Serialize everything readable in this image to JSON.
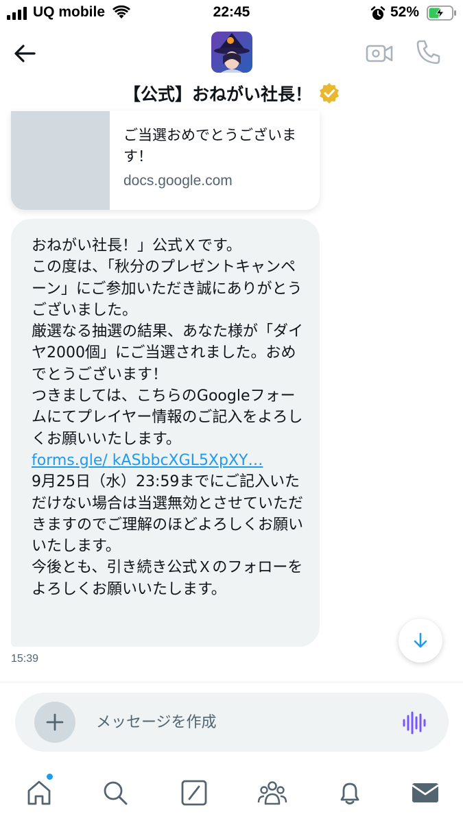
{
  "status_bar": {
    "carrier": "UQ mobile",
    "time": "22:45",
    "battery_percent": "52%",
    "battery_level": 0.52,
    "icons": [
      "signal-icon",
      "wifi-icon",
      "alarm-icon",
      "battery-charging-icon"
    ]
  },
  "header": {
    "title": "【公式】おねがい社長！",
    "verified": true,
    "icons": [
      "back-arrow-icon",
      "video-call-icon",
      "phone-icon",
      "verified-badge-icon"
    ]
  },
  "link_card": {
    "title": "ご当選おめでとうございます！",
    "domain": "docs.google.com"
  },
  "message": {
    "text_before_link": "おねがい社長！」公式Ｘです。\nこの度は、「秋分のプレゼントキャンペーン」にご参加いただき誠にありがとうございました。\n厳選なる抽選の結果、あなた様が「ダイヤ2000個」にご当選されました。おめでとうございます！\nつきましては、こちらのGoogleフォームにてプレイヤー情報のご記入をよろしくお願いいたします。 ",
    "link_line1": "forms.gle/",
    "link_line2": "kASbbcXGL5XpXY…",
    "text_after_link": "\n9月25日（水）23:59までにご記入いただけない場合は当選無効とさせていただきますのでご理解のほどよろしくお願いいたします。\n今後とも、引き続き公式Ｘのフォローをよろしくお願いいたします。",
    "timestamp": "15:39"
  },
  "composer": {
    "placeholder": "メッセージを作成",
    "value": ""
  },
  "bottom_nav": {
    "items": [
      "home-icon",
      "search-icon",
      "grok-icon",
      "communities-icon",
      "notifications-icon",
      "messages-icon"
    ],
    "has_new_home_dot": true
  },
  "colors": {
    "accent": "#1d9bf0",
    "bubble_bg": "#eff3f4",
    "text_primary": "#0f1419",
    "text_secondary": "#536471",
    "verified_gold": "#e8b830",
    "voice_purple": "#7856ff"
  }
}
